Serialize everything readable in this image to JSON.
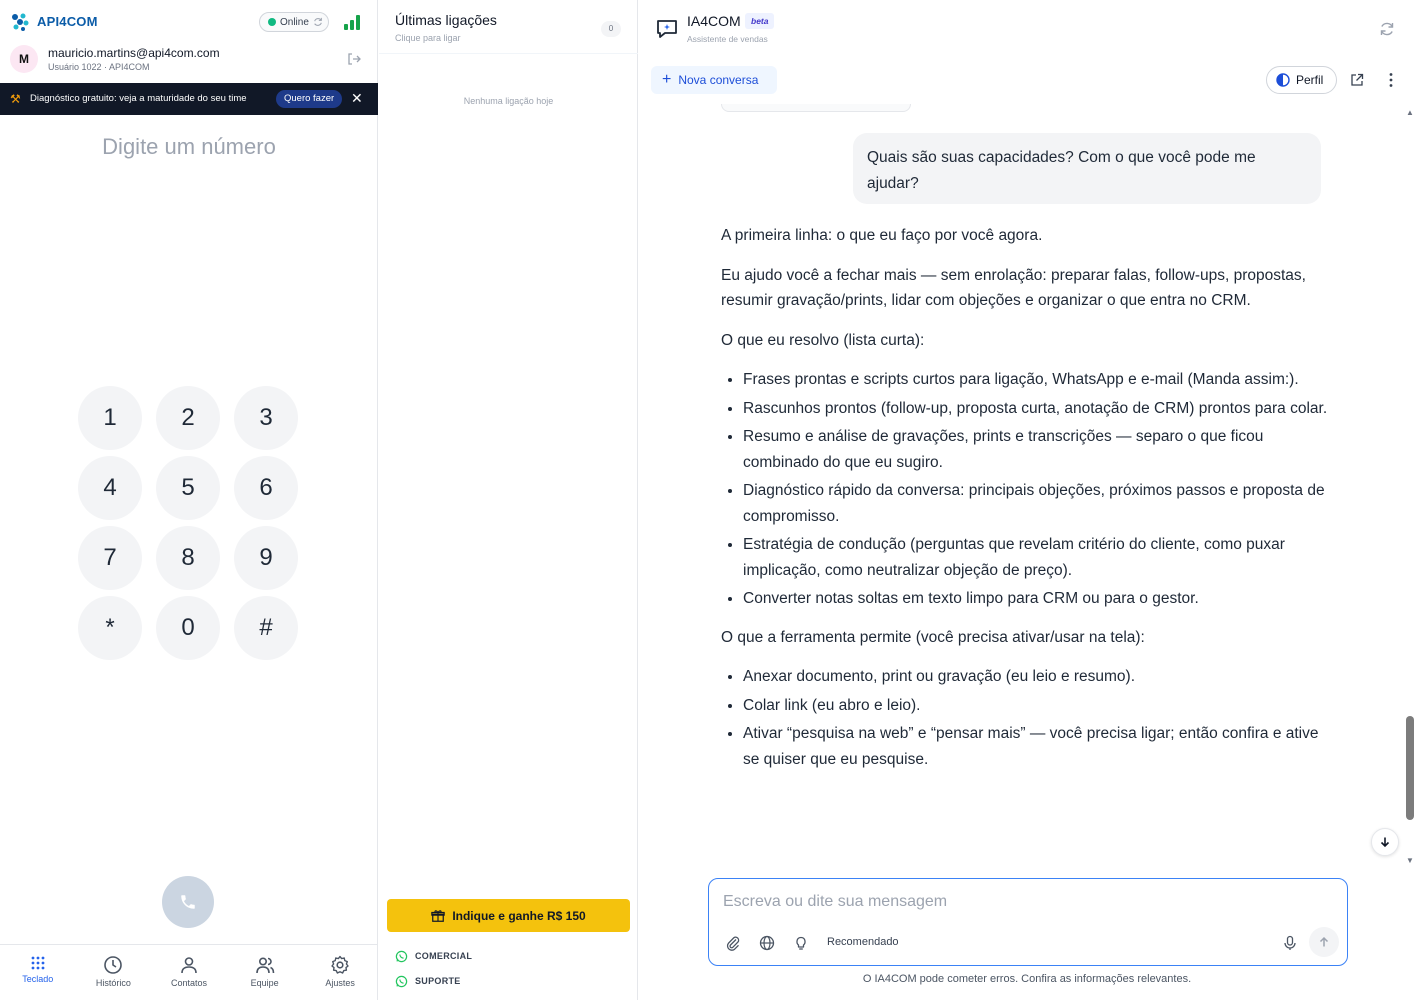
{
  "left_panel": {
    "brand": "API4COM",
    "status": "Online",
    "user": {
      "avatar_initial": "M",
      "email": "mauricio.martins@api4com.com",
      "subtitle": "Usuário 1022 · API4COM"
    },
    "banner": {
      "text": "Diagnóstico gratuito: veja a maturidade do seu time",
      "button": "Quero fazer",
      "close": "✕"
    },
    "dial_placeholder": "Digite um número",
    "keypad": [
      "1",
      "2",
      "3",
      "4",
      "5",
      "6",
      "7",
      "8",
      "9",
      "*",
      "0",
      "#"
    ],
    "nav": [
      {
        "label": "Teclado",
        "icon": "keypad-icon",
        "active": true
      },
      {
        "label": "Histórico",
        "icon": "clock-icon",
        "active": false
      },
      {
        "label": "Contatos",
        "icon": "person-icon",
        "active": false
      },
      {
        "label": "Equipe",
        "icon": "team-icon",
        "active": false
      },
      {
        "label": "Ajustes",
        "icon": "gear-icon",
        "active": false
      }
    ]
  },
  "middle_panel": {
    "title": "Últimas ligações",
    "subtitle": "Clique para ligar",
    "count": "0",
    "empty_text": "Nenhuma ligação hoje",
    "referral_button": "Indique e ganhe R$ 150",
    "links": [
      "COMERCIAL",
      "SUPORTE"
    ]
  },
  "right_panel": {
    "title": "IA4COM",
    "badge": "beta",
    "subtitle": "Assistente de vendas",
    "new_conversation": "Nova conversa",
    "profile_button": "Perfil",
    "user_message": "Quais são suas capacidades? Com o que você pode me ajudar?",
    "answer": {
      "p1": "A primeira linha: o que eu faço por você agora.",
      "p2": "Eu ajudo você a fechar mais — sem enrolação: preparar falas, follow-ups, propostas, resumir gravação/prints, lidar com objeções e organizar o que entra no CRM.",
      "p3": "O que eu resolvo (lista curta):",
      "list1": [
        "Frases prontas e scripts curtos para ligação, WhatsApp e e-mail (Manda assim:).",
        "Rascunhos prontos (follow-up, proposta curta, anotação de CRM) prontos para colar.",
        "Resumo e análise de gravações, prints e transcrições — separo o que ficou combinado do que eu sugiro.",
        "Diagnóstico rápido da conversa: principais objeções, próximos passos e proposta de compromisso.",
        "Estratégia de condução (perguntas que revelam critério do cliente, como puxar implicação, como neutralizar objeção de preço).",
        "Converter notas soltas em texto limpo para CRM ou para o gestor."
      ],
      "p4": "O que a ferramenta permite (você precisa ativar/usar na tela):",
      "list2": [
        "Anexar documento, print ou gravação (eu leio e resumo).",
        "Colar link (eu abro e leio).",
        "Ativar “pesquisa na web” e “pensar mais” — você precisa ligar; então confira e ative se quiser que eu pesquise."
      ]
    },
    "composer": {
      "placeholder": "Escreva ou dite sua mensagem",
      "mode_label": "Recomendado"
    },
    "disclaimer": "O IA4COM pode cometer erros. Confira as informações relevantes."
  },
  "colors": {
    "brand_blue": "#0b5ca8",
    "accent_blue": "#2563eb",
    "referral_yellow": "#f4c20d",
    "online_green": "#10b981",
    "banner_dark": "#111827"
  }
}
